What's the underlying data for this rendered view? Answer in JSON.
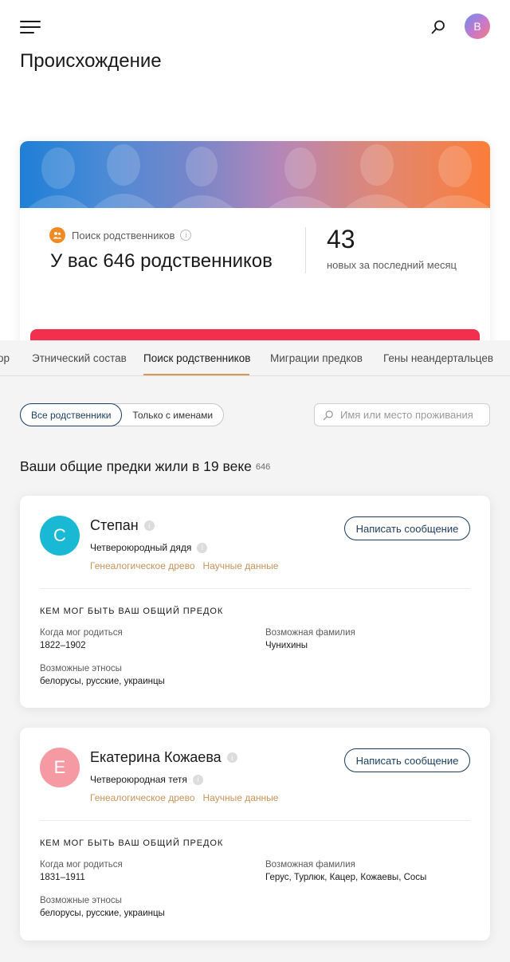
{
  "header": {
    "menu_icon": "hamburger-menu-icon",
    "search_icon": "search-icon",
    "avatar_letter": "В",
    "page_title": "Происхождение"
  },
  "hero": {
    "label": "Поиск родственников",
    "relatives_text": "У вас 646 родственников",
    "new_count": "43",
    "new_label": "новых за последний месяц",
    "accent_color": "#f2304e"
  },
  "tabs": [
    {
      "label": "ор"
    },
    {
      "label": "Этнический состав"
    },
    {
      "label": "Поиск родственников",
      "active": true
    },
    {
      "label": "Миграции предков"
    },
    {
      "label": "Гены неандертальцев"
    }
  ],
  "filters": {
    "all_label": "Все родственники",
    "named_label": "Только с именами",
    "search_placeholder": "Имя или место проживания"
  },
  "section": {
    "title": "Ваши общие предки жили в 19 веке",
    "count": "646"
  },
  "cards": [
    {
      "initial": "С",
      "avatar_color": "#19b8d4",
      "name": "Степан",
      "relation": "Четвероюродный дядя",
      "link_tree": "Генеалогическое древо",
      "link_science": "Научные данные",
      "message_label": "Написать сообщение",
      "ancestor_heading": "КЕМ МОГ БЫТЬ ВАШ ОБЩИЙ ПРЕДОК",
      "birth_label": "Когда мог родиться",
      "birth_value": "1822–1902",
      "surname_label": "Возможная фамилия",
      "surname_value": "Чунихины",
      "ethnos_label": "Возможные этносы",
      "ethnos_value": "белорусы, русские, украинцы"
    },
    {
      "initial": "Е",
      "avatar_color": "#f59aa2",
      "name": "Екатерина Кожаева",
      "relation": "Четвероюродная тетя",
      "link_tree": "Генеалогическое древо",
      "link_science": "Научные данные",
      "message_label": "Написать сообщение",
      "ancestor_heading": "КЕМ МОГ БЫТЬ ВАШ ОБЩИЙ ПРЕДОК",
      "birth_label": "Когда мог родиться",
      "birth_value": "1831–1911",
      "surname_label": "Возможная фамилия",
      "surname_value": "Герус, Турлюк, Кацер, Кожаевы, Сосы",
      "ethnos_label": "Возможные этносы",
      "ethnos_value": "белорусы, русские, украинцы"
    }
  ]
}
